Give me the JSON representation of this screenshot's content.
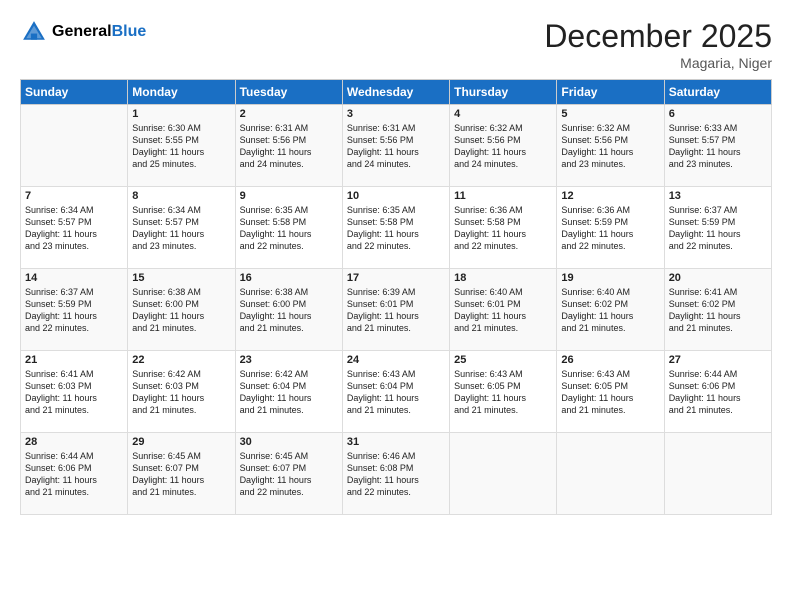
{
  "logo": {
    "line1": "General",
    "line2": "Blue"
  },
  "title": "December 2025",
  "subtitle": "Magaria, Niger",
  "header_days": [
    "Sunday",
    "Monday",
    "Tuesday",
    "Wednesday",
    "Thursday",
    "Friday",
    "Saturday"
  ],
  "weeks": [
    [
      {
        "day": "",
        "lines": []
      },
      {
        "day": "1",
        "lines": [
          "Sunrise: 6:30 AM",
          "Sunset: 5:55 PM",
          "Daylight: 11 hours",
          "and 25 minutes."
        ]
      },
      {
        "day": "2",
        "lines": [
          "Sunrise: 6:31 AM",
          "Sunset: 5:56 PM",
          "Daylight: 11 hours",
          "and 24 minutes."
        ]
      },
      {
        "day": "3",
        "lines": [
          "Sunrise: 6:31 AM",
          "Sunset: 5:56 PM",
          "Daylight: 11 hours",
          "and 24 minutes."
        ]
      },
      {
        "day": "4",
        "lines": [
          "Sunrise: 6:32 AM",
          "Sunset: 5:56 PM",
          "Daylight: 11 hours",
          "and 24 minutes."
        ]
      },
      {
        "day": "5",
        "lines": [
          "Sunrise: 6:32 AM",
          "Sunset: 5:56 PM",
          "Daylight: 11 hours",
          "and 23 minutes."
        ]
      },
      {
        "day": "6",
        "lines": [
          "Sunrise: 6:33 AM",
          "Sunset: 5:57 PM",
          "Daylight: 11 hours",
          "and 23 minutes."
        ]
      }
    ],
    [
      {
        "day": "7",
        "lines": [
          "Sunrise: 6:34 AM",
          "Sunset: 5:57 PM",
          "Daylight: 11 hours",
          "and 23 minutes."
        ]
      },
      {
        "day": "8",
        "lines": [
          "Sunrise: 6:34 AM",
          "Sunset: 5:57 PM",
          "Daylight: 11 hours",
          "and 23 minutes."
        ]
      },
      {
        "day": "9",
        "lines": [
          "Sunrise: 6:35 AM",
          "Sunset: 5:58 PM",
          "Daylight: 11 hours",
          "and 22 minutes."
        ]
      },
      {
        "day": "10",
        "lines": [
          "Sunrise: 6:35 AM",
          "Sunset: 5:58 PM",
          "Daylight: 11 hours",
          "and 22 minutes."
        ]
      },
      {
        "day": "11",
        "lines": [
          "Sunrise: 6:36 AM",
          "Sunset: 5:58 PM",
          "Daylight: 11 hours",
          "and 22 minutes."
        ]
      },
      {
        "day": "12",
        "lines": [
          "Sunrise: 6:36 AM",
          "Sunset: 5:59 PM",
          "Daylight: 11 hours",
          "and 22 minutes."
        ]
      },
      {
        "day": "13",
        "lines": [
          "Sunrise: 6:37 AM",
          "Sunset: 5:59 PM",
          "Daylight: 11 hours",
          "and 22 minutes."
        ]
      }
    ],
    [
      {
        "day": "14",
        "lines": [
          "Sunrise: 6:37 AM",
          "Sunset: 5:59 PM",
          "Daylight: 11 hours",
          "and 22 minutes."
        ]
      },
      {
        "day": "15",
        "lines": [
          "Sunrise: 6:38 AM",
          "Sunset: 6:00 PM",
          "Daylight: 11 hours",
          "and 21 minutes."
        ]
      },
      {
        "day": "16",
        "lines": [
          "Sunrise: 6:38 AM",
          "Sunset: 6:00 PM",
          "Daylight: 11 hours",
          "and 21 minutes."
        ]
      },
      {
        "day": "17",
        "lines": [
          "Sunrise: 6:39 AM",
          "Sunset: 6:01 PM",
          "Daylight: 11 hours",
          "and 21 minutes."
        ]
      },
      {
        "day": "18",
        "lines": [
          "Sunrise: 6:40 AM",
          "Sunset: 6:01 PM",
          "Daylight: 11 hours",
          "and 21 minutes."
        ]
      },
      {
        "day": "19",
        "lines": [
          "Sunrise: 6:40 AM",
          "Sunset: 6:02 PM",
          "Daylight: 11 hours",
          "and 21 minutes."
        ]
      },
      {
        "day": "20",
        "lines": [
          "Sunrise: 6:41 AM",
          "Sunset: 6:02 PM",
          "Daylight: 11 hours",
          "and 21 minutes."
        ]
      }
    ],
    [
      {
        "day": "21",
        "lines": [
          "Sunrise: 6:41 AM",
          "Sunset: 6:03 PM",
          "Daylight: 11 hours",
          "and 21 minutes."
        ]
      },
      {
        "day": "22",
        "lines": [
          "Sunrise: 6:42 AM",
          "Sunset: 6:03 PM",
          "Daylight: 11 hours",
          "and 21 minutes."
        ]
      },
      {
        "day": "23",
        "lines": [
          "Sunrise: 6:42 AM",
          "Sunset: 6:04 PM",
          "Daylight: 11 hours",
          "and 21 minutes."
        ]
      },
      {
        "day": "24",
        "lines": [
          "Sunrise: 6:43 AM",
          "Sunset: 6:04 PM",
          "Daylight: 11 hours",
          "and 21 minutes."
        ]
      },
      {
        "day": "25",
        "lines": [
          "Sunrise: 6:43 AM",
          "Sunset: 6:05 PM",
          "Daylight: 11 hours",
          "and 21 minutes."
        ]
      },
      {
        "day": "26",
        "lines": [
          "Sunrise: 6:43 AM",
          "Sunset: 6:05 PM",
          "Daylight: 11 hours",
          "and 21 minutes."
        ]
      },
      {
        "day": "27",
        "lines": [
          "Sunrise: 6:44 AM",
          "Sunset: 6:06 PM",
          "Daylight: 11 hours",
          "and 21 minutes."
        ]
      }
    ],
    [
      {
        "day": "28",
        "lines": [
          "Sunrise: 6:44 AM",
          "Sunset: 6:06 PM",
          "Daylight: 11 hours",
          "and 21 minutes."
        ]
      },
      {
        "day": "29",
        "lines": [
          "Sunrise: 6:45 AM",
          "Sunset: 6:07 PM",
          "Daylight: 11 hours",
          "and 21 minutes."
        ]
      },
      {
        "day": "30",
        "lines": [
          "Sunrise: 6:45 AM",
          "Sunset: 6:07 PM",
          "Daylight: 11 hours",
          "and 22 minutes."
        ]
      },
      {
        "day": "31",
        "lines": [
          "Sunrise: 6:46 AM",
          "Sunset: 6:08 PM",
          "Daylight: 11 hours",
          "and 22 minutes."
        ]
      },
      {
        "day": "",
        "lines": []
      },
      {
        "day": "",
        "lines": []
      },
      {
        "day": "",
        "lines": []
      }
    ]
  ]
}
